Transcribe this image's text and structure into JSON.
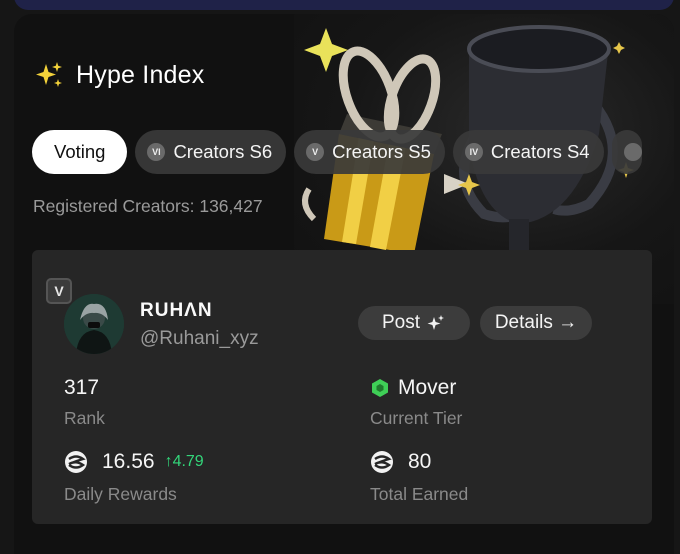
{
  "header": {
    "title": "Hype Index",
    "registered_label": "Registered Creators:",
    "registered_count": "136,427"
  },
  "tabs": [
    {
      "label": "Voting",
      "active": true
    },
    {
      "label": "Creators S6",
      "badge": "VI"
    },
    {
      "label": "Creators S5",
      "badge": "V"
    },
    {
      "label": "Creators S4",
      "badge": "IV"
    }
  ],
  "profile": {
    "season_badge": "V",
    "name": "RUHΛN",
    "handle": "@Ruhani_xyz",
    "post_label": "Post",
    "details_label": "Details →"
  },
  "stats": {
    "rank_value": "317",
    "rank_label": "Rank",
    "tier_value": "Mover",
    "tier_label": "Current Tier",
    "daily_value": "16.56",
    "daily_delta": "↑4.79",
    "daily_label": "Daily Rewards",
    "total_value": "80",
    "total_label": "Total Earned"
  },
  "colors": {
    "accent_gold": "#e9c84a",
    "delta_green": "#33d67a",
    "tier_green": "#3fcf57",
    "card_bg": "#262626",
    "page_bg": "#111111"
  },
  "icons": {
    "title": "sparkle-icon",
    "post": "sparkle-icon",
    "details": "arrow-right-icon",
    "currency": "coin-icon",
    "tier": "hexagon-tier-icon"
  }
}
